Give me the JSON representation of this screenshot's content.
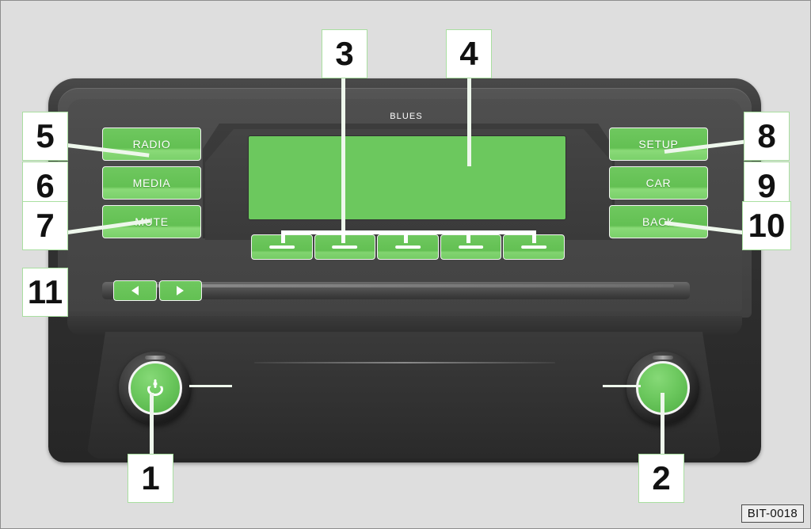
{
  "figure": {
    "id_label": "BIT-0018",
    "brand_text": "BLUES",
    "background_color": "#dedede",
    "accent_green": "#6cc85e",
    "callout_box_color": "#ffffff",
    "callout_border_color": "#a9dfa0"
  },
  "device": {
    "name": "car-radio-faceplate",
    "display": {
      "label": "",
      "color": "#6cc85e"
    }
  },
  "left_buttons": [
    {
      "label": "RADIO",
      "callout": "5"
    },
    {
      "label": "MEDIA",
      "callout": "6"
    },
    {
      "label": "MUTE",
      "callout": "7"
    }
  ],
  "right_buttons": [
    {
      "label": "SETUP",
      "callout": "8"
    },
    {
      "label": "CAR",
      "callout": "9"
    },
    {
      "label": "BACK",
      "callout": "10"
    }
  ],
  "function_buttons": [
    {
      "label": ""
    },
    {
      "label": ""
    },
    {
      "label": ""
    },
    {
      "label": ""
    },
    {
      "label": ""
    }
  ],
  "skip_buttons": [
    {
      "icon": "triangle-left-icon"
    },
    {
      "icon": "triangle-right-icon"
    }
  ],
  "knobs": [
    {
      "name": "power-volume-knob",
      "icon": "power-icon",
      "callout": "1"
    },
    {
      "name": "menu-select-knob",
      "icon": "",
      "callout": "2"
    }
  ],
  "callouts": {
    "c1": "1",
    "c2": "2",
    "c3": "3",
    "c4": "4",
    "c5": "5",
    "c6": "6",
    "c7": "7",
    "c8": "8",
    "c9": "9",
    "c10": "10",
    "c11": "11"
  }
}
